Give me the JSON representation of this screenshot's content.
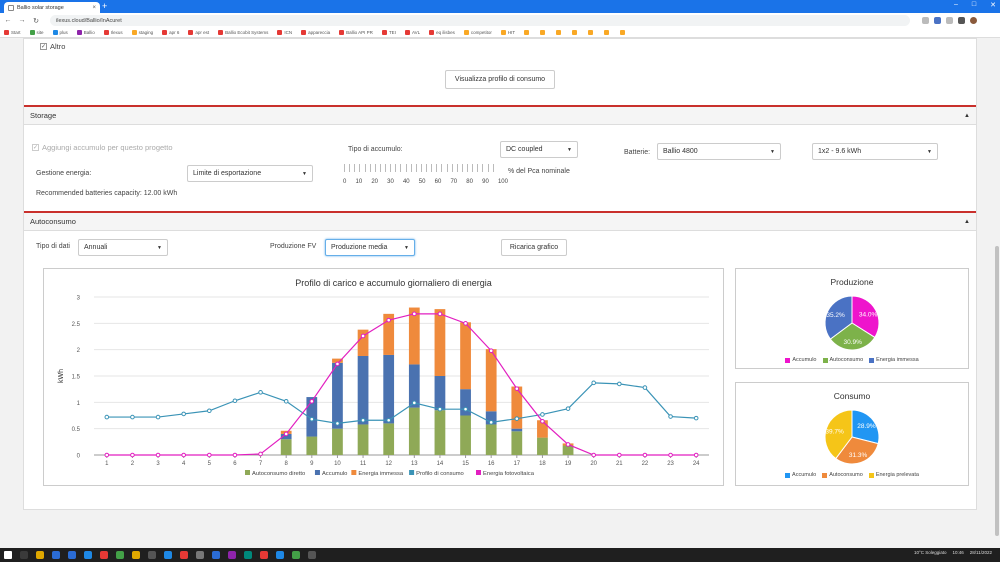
{
  "browser": {
    "tab_title": "Ballio solar storage",
    "tab_close": "×",
    "new_tab": "+",
    "url": "ilexus.cloud/Ballio/InAcuret",
    "bookmarks": [
      "Start",
      "site",
      "plus",
      "Ballio",
      "Ilexus",
      "staging",
      "apr 6",
      "apr est",
      "Ballio Ecobit Systems",
      "ICN",
      "appareccia",
      "Ballio API PR",
      "TEI",
      "AVL",
      "eq ilisbes",
      "competitor",
      "HIT",
      "",
      "",
      "",
      "",
      "",
      "",
      ""
    ],
    "controls": {
      "minimize": "–",
      "maximize": "□",
      "close": "✕"
    }
  },
  "top": {
    "altro_label": "Altro",
    "altro_check": "✓",
    "view_profile_button": "Visualizza profilo di consumo"
  },
  "storage": {
    "title": "Storage",
    "collapse": "▲",
    "add_accumulo_label": "Aggiungi accumulo per questo progetto",
    "add_accumulo_check": "✓",
    "tipo_label": "Tipo di accumulo:",
    "tipo_value": "DC coupled",
    "batterie_label": "Batterie:",
    "batterie_value": "Ballio 4800",
    "config_value": "1x2 - 9.6 kWh",
    "gestione_label": "Gestione energia:",
    "gestione_value": "Limite di esportazione",
    "slider_unit": "% del Pca nominale",
    "slider_ticks": [
      "0",
      "10",
      "20",
      "30",
      "40",
      "50",
      "60",
      "70",
      "80",
      "90",
      "100"
    ],
    "recommended": "Recommended batteries capacity: 12.00 kWh",
    "arrow": "▼"
  },
  "autoconsumo": {
    "title": "Autoconsumo",
    "collapse": "▲",
    "tipo_dati_label": "Tipo di dati",
    "tipo_dati_value": "Annuali",
    "produzione_label": "Produzione FV",
    "produzione_value": "Produzione media",
    "ricarica_button": "Ricarica grafico"
  },
  "chart_data": [
    {
      "type": "bar",
      "title": "Profilo di carico e accumulo giornaliero di energia",
      "ylabel": "kWh",
      "ylim": [
        0,
        3
      ],
      "yticks": [
        "0",
        "0.5",
        "1",
        "1.5",
        "2",
        "2.5",
        "3"
      ],
      "categories": [
        "1",
        "2",
        "3",
        "4",
        "5",
        "6",
        "7",
        "8",
        "9",
        "10",
        "11",
        "12",
        "13",
        "14",
        "15",
        "16",
        "17",
        "18",
        "19",
        "20",
        "21",
        "22",
        "23",
        "24"
      ],
      "stacked": true,
      "grid": true,
      "legend": "bottom",
      "series": [
        {
          "name": "Autoconsumo diretto",
          "kind": "bar",
          "color": "#8fa957",
          "values": [
            0,
            0,
            0,
            0,
            0,
            0,
            0,
            0.3,
            0.35,
            0.5,
            0.58,
            0.6,
            0.9,
            0.85,
            0.75,
            0.58,
            0.45,
            0.33,
            0.18,
            0,
            0,
            0,
            0,
            0
          ]
        },
        {
          "name": "Accumulo",
          "kind": "bar",
          "color": "#4a72b0",
          "values": [
            0,
            0,
            0,
            0,
            0,
            0,
            0,
            0.1,
            0.75,
            1.25,
            1.3,
            1.3,
            0.82,
            0.65,
            0.5,
            0.25,
            0.05,
            0,
            0,
            0,
            0,
            0,
            0,
            0
          ]
        },
        {
          "name": "Energia immessa",
          "kind": "bar",
          "color": "#ef8a3c",
          "values": [
            0,
            0,
            0,
            0,
            0,
            0,
            0,
            0.06,
            0,
            0.08,
            0.5,
            0.78,
            1.08,
            1.27,
            1.27,
            1.18,
            0.8,
            0.33,
            0.04,
            0,
            0,
            0,
            0,
            0
          ]
        },
        {
          "name": "Profilo di consumo",
          "kind": "line",
          "color": "#3a93b6",
          "values": [
            0.72,
            0.72,
            0.72,
            0.78,
            0.84,
            1.03,
            1.19,
            1.02,
            0.68,
            0.6,
            0.66,
            0.66,
            0.99,
            0.87,
            0.87,
            0.62,
            0.69,
            0.77,
            0.88,
            1.37,
            1.35,
            1.28,
            0.73,
            0.7
          ]
        },
        {
          "name": "Energia fotovoltaica",
          "kind": "line",
          "color": "#e21fc0",
          "values": [
            0,
            0,
            0,
            0,
            0,
            0,
            0.02,
            0.4,
            1.02,
            1.73,
            2.26,
            2.56,
            2.68,
            2.68,
            2.5,
            1.98,
            1.26,
            0.64,
            0.2,
            0,
            0,
            0,
            0,
            0
          ]
        }
      ]
    },
    {
      "type": "pie",
      "title": "Produzione",
      "slices": [
        {
          "name": "Accumulo",
          "value": 34.0,
          "label": "34.0%",
          "color": "#ee14cc"
        },
        {
          "name": "Autoconsumo",
          "value": 30.9,
          "label": "30.9%",
          "color": "#7db24a"
        },
        {
          "name": "Energia immessa",
          "value": 35.2,
          "label": "35.2%",
          "color": "#4a72c4"
        }
      ]
    },
    {
      "type": "pie",
      "title": "Consumo",
      "slices": [
        {
          "name": "Accumulo",
          "value": 28.9,
          "label": "28.9%",
          "color": "#2196f3"
        },
        {
          "name": "Autoconsumo",
          "value": 31.3,
          "label": "31.3%",
          "color": "#ef8a3c"
        },
        {
          "name": "Energia prelevata",
          "value": 39.7,
          "label": "39.7%",
          "color": "#f5c518"
        }
      ]
    }
  ],
  "colors": {
    "accent_red": "#c9302c",
    "focus_blue": "#66afe9"
  },
  "taskbar": {
    "weather": "10°C Soleggiato",
    "time": "10:46",
    "date": "28/11/2022"
  }
}
